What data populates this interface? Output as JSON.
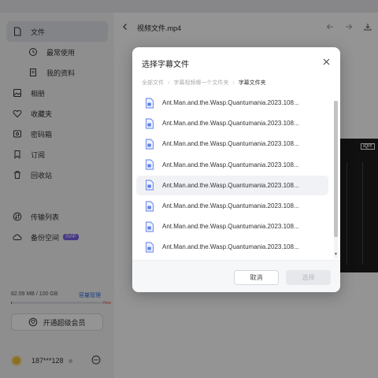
{
  "sidebar": {
    "items": [
      {
        "label": "文件",
        "icon": "file-icon",
        "active": true
      },
      {
        "label": "最常使用",
        "icon": "clock-icon"
      },
      {
        "label": "我的资料",
        "icon": "document-icon"
      },
      {
        "label": "相册",
        "icon": "image-icon"
      },
      {
        "label": "收藏夹",
        "icon": "heart-icon"
      },
      {
        "label": "密码箱",
        "icon": "safe-icon"
      },
      {
        "label": "订阅",
        "icon": "bookmark-icon"
      },
      {
        "label": "回收站",
        "icon": "trash-icon"
      },
      {
        "label": "传输列表",
        "icon": "transfer-icon"
      },
      {
        "label": "备份空间",
        "icon": "cloud-icon",
        "badge": "SVIP"
      }
    ],
    "storage": {
      "text": "82.09 MB / 100 GB",
      "expand": "容量管理",
      "new_tag": "New",
      "used_fraction": 0.001
    },
    "upgrade_label": "开通超级会员",
    "user": {
      "name": "187***128"
    }
  },
  "main": {
    "title": "视频文件.mp4",
    "video_logo": "iQIY"
  },
  "dialog": {
    "title": "选择字幕文件",
    "breadcrumb": [
      "全部文件",
      "字幕视频哪一个文件夹",
      "字幕文件夹"
    ],
    "files": [
      "Ant.Man.and.the.Wasp.Quantumania.2023.108...",
      "Ant.Man.and.the.Wasp.Quantumania.2023.108...",
      "Ant.Man.and.the.Wasp.Quantumania.2023.108...",
      "Ant.Man.and.the.Wasp.Quantumania.2023.108...",
      "Ant.Man.and.the.Wasp.Quantumania.2023.108...",
      "Ant.Man.and.the.Wasp.Quantumania.2023.108...",
      "Ant.Man.and.the.Wasp.Quantumania.2023.108...",
      "Ant.Man.and.the.Wasp.Quantumania.2023.108..."
    ],
    "hover_index": 4,
    "cancel_label": "取消",
    "select_label": "选择"
  },
  "colors": {
    "accent": "#3a6de0",
    "file_icon": "#5b7fea"
  }
}
